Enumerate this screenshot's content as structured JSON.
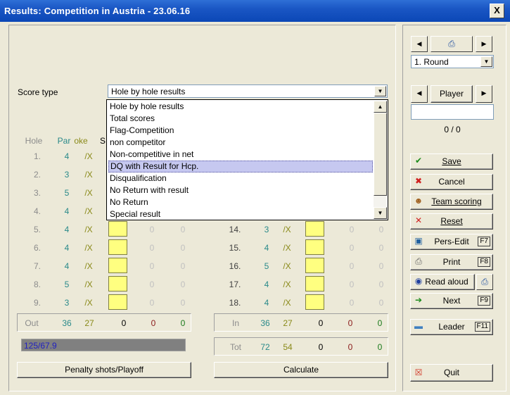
{
  "window": {
    "title": "Results: Competition in Austria - 23.06.16",
    "close_glyph": "X"
  },
  "score_type": {
    "label": "Score type",
    "value": "Hole by hole results",
    "options": [
      "Hole by hole results",
      "Total scores",
      "Flag-Competition",
      "non competitor",
      "Non-competitive in net",
      "DQ with Result for Hcp.",
      "Disqualification",
      "No Return with result",
      "No Return",
      "Special result"
    ],
    "highlighted_index": 5
  },
  "table": {
    "headers": {
      "hole": "Hole",
      "par": "Par",
      "stroke": "oke",
      "s": "S"
    },
    "mark": "/X",
    "front": [
      {
        "hole": "1.",
        "par": "4"
      },
      {
        "hole": "2.",
        "par": "3"
      },
      {
        "hole": "3.",
        "par": "5"
      },
      {
        "hole": "4.",
        "par": "4"
      },
      {
        "hole": "5.",
        "par": "4",
        "a": "0",
        "b": "0"
      },
      {
        "hole": "6.",
        "par": "4",
        "a": "0",
        "b": "0"
      },
      {
        "hole": "7.",
        "par": "4",
        "a": "0",
        "b": "0"
      },
      {
        "hole": "8.",
        "par": "5",
        "a": "0",
        "b": "0"
      },
      {
        "hole": "9.",
        "par": "3",
        "a": "0",
        "b": "0"
      }
    ],
    "back": [
      {
        "hole": "14.",
        "par": "3",
        "a": "0",
        "b": "0"
      },
      {
        "hole": "15.",
        "par": "4",
        "a": "0",
        "b": "0"
      },
      {
        "hole": "16.",
        "par": "5",
        "a": "0",
        "b": "0"
      },
      {
        "hole": "17.",
        "par": "4",
        "a": "0",
        "b": "0"
      },
      {
        "hole": "18.",
        "par": "4",
        "a": "0",
        "b": "0"
      }
    ],
    "out": {
      "label": "Out",
      "par": "36",
      "stroke": "27",
      "score": "0",
      "red": "0",
      "green": "0"
    },
    "in": {
      "label": "In",
      "par": "36",
      "stroke": "27",
      "score": "0",
      "red": "0",
      "green": "0"
    },
    "tot": {
      "label": "Tot",
      "par": "72",
      "stroke": "54",
      "score": "0",
      "red": "0",
      "green": "0"
    }
  },
  "handicap_bar": {
    "text": "125/67.9"
  },
  "buttons": {
    "penalty": "Penalty shots/Playoff",
    "calculate": "Calculate"
  },
  "sidebar": {
    "round_value": "1. Round",
    "player_label": "Player",
    "player_value": "",
    "player_count": "0 / 0",
    "save": "Save",
    "cancel": "Cancel",
    "team_scoring": "Team scoring",
    "reset": "Reset",
    "pers_edit": "Pers-Edit",
    "pers_edit_key": "F7",
    "print": "Print",
    "print_key": "F8",
    "read_aloud": "Read aloud",
    "next": "Next",
    "next_key": "F9",
    "leader": "Leader",
    "leader_key": "F11",
    "quit": "Quit"
  },
  "colors": {
    "title_bar": "#0b47b6",
    "window_bg": "#ece9d8",
    "score_box": "#ffff80",
    "highlight": "#c6c8f0",
    "par_teal": "#2a8a8a",
    "stroke_olive": "#8a8a1a"
  }
}
